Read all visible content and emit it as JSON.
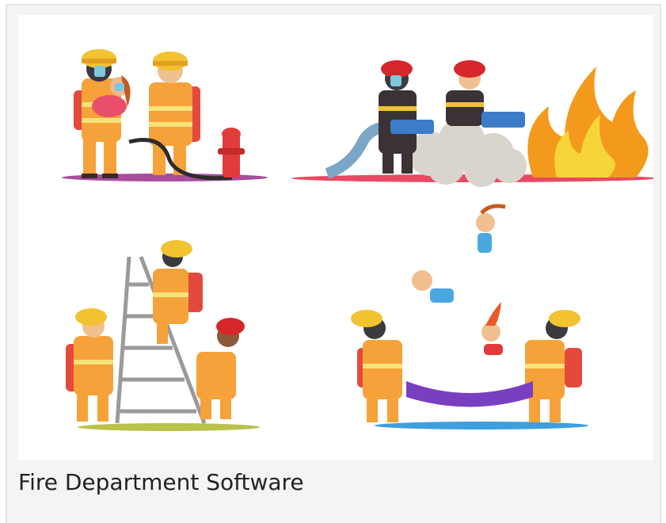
{
  "card": {
    "caption": "Fire Department Software"
  },
  "illustration": {
    "scenes": [
      {
        "name": "rescue-scene"
      },
      {
        "name": "hose-scene"
      },
      {
        "name": "ladder-scene"
      },
      {
        "name": "net-scene"
      }
    ]
  }
}
